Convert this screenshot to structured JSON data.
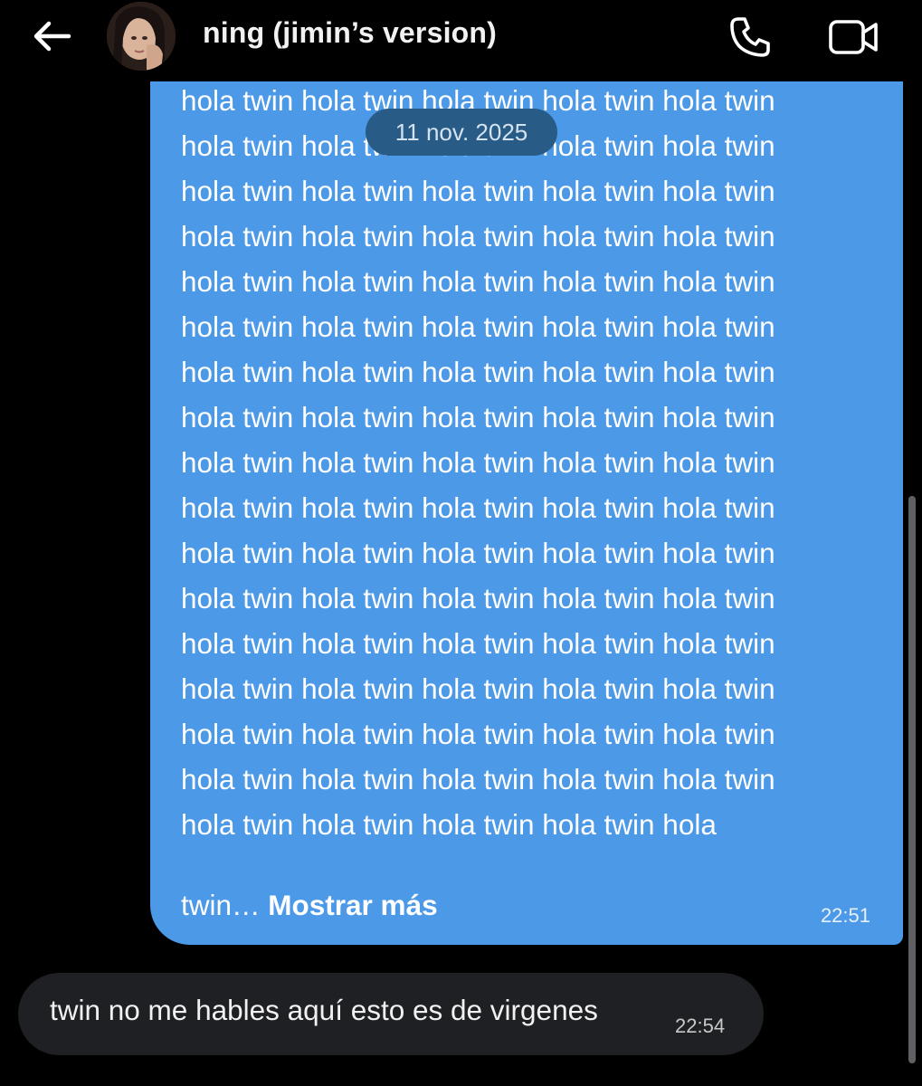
{
  "header": {
    "contact_name": "ning (jimin’s version)",
    "icons": {
      "back": "back-arrow-icon",
      "call": "phone-icon",
      "video": "video-camera-icon"
    }
  },
  "conversation": {
    "date_separator": "11 nov. 2025",
    "sent_message": {
      "lines": [
        "hola twin hola twin hola twin hola twin hola twin",
        "hola twin hola twin hola twin hola twin hola twin",
        "hola twin hola twin hola twin hola twin hola twin",
        "hola twin hola twin hola twin hola twin hola twin",
        "hola twin hola twin hola twin hola twin hola twin",
        "hola twin hola twin hola twin hola twin hola twin",
        "hola twin hola twin hola twin hola twin hola twin",
        "hola twin hola twin hola twin hola twin hola twin",
        "hola twin hola twin hola twin hola twin hola twin",
        "hola twin hola twin hola twin hola twin hola twin",
        "hola twin hola twin hola twin hola twin hola twin",
        "hola twin hola twin hola twin hola twin hola twin",
        "hola twin hola twin hola twin hola twin hola twin",
        "hola twin hola twin hola twin hola twin hola twin",
        "hola twin hola twin hola twin hola twin hola twin",
        "hola twin hola twin hola twin hola twin hola twin",
        "hola twin hola twin hola twin hola twin hola twin",
        "hola twin hola twin hola twin hola twin hola"
      ],
      "truncated_tail": "twin… ",
      "show_more_label": "Mostrar más",
      "time": "22:51",
      "bubble_color": "#4c99e8"
    },
    "received_message": {
      "text": "twin no me hables aquí esto es de virgenes",
      "time": "22:54",
      "bubble_color": "#1f2023"
    }
  },
  "theme": {
    "background": "#000000",
    "date_pill_color": "#285b86"
  }
}
